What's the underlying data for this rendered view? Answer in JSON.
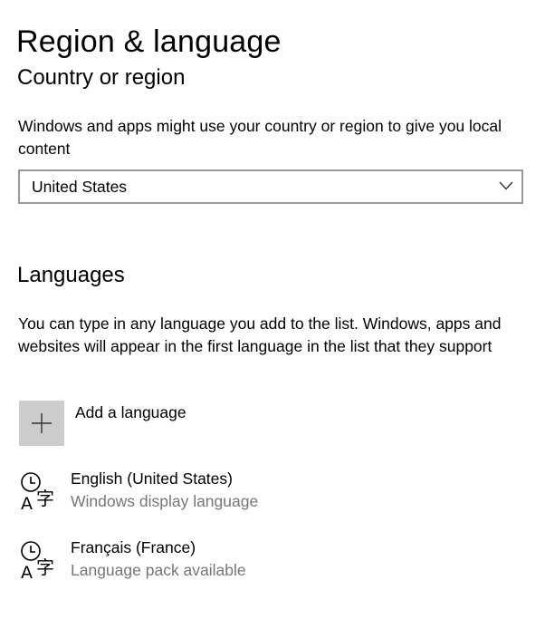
{
  "page": {
    "title": "Region & language"
  },
  "country_region": {
    "heading": "Country or region",
    "description": "Windows and apps might use your country or region to give you local content",
    "selected_value": "United States"
  },
  "languages": {
    "heading": "Languages",
    "description": "You can type in any language you add to the list. Windows, apps and websites will appear in the first language in the list that they support",
    "add_label": "Add a language",
    "items": [
      {
        "name": "English (United States)",
        "status": "Windows display language",
        "icon": "language-settings-icon"
      },
      {
        "name": "Français (France)",
        "status": "Language pack available",
        "icon": "language-settings-icon"
      }
    ]
  },
  "colors": {
    "text": "#000000",
    "secondary_text": "#767676",
    "border": "#999999",
    "add_tile": "#cccccc"
  }
}
